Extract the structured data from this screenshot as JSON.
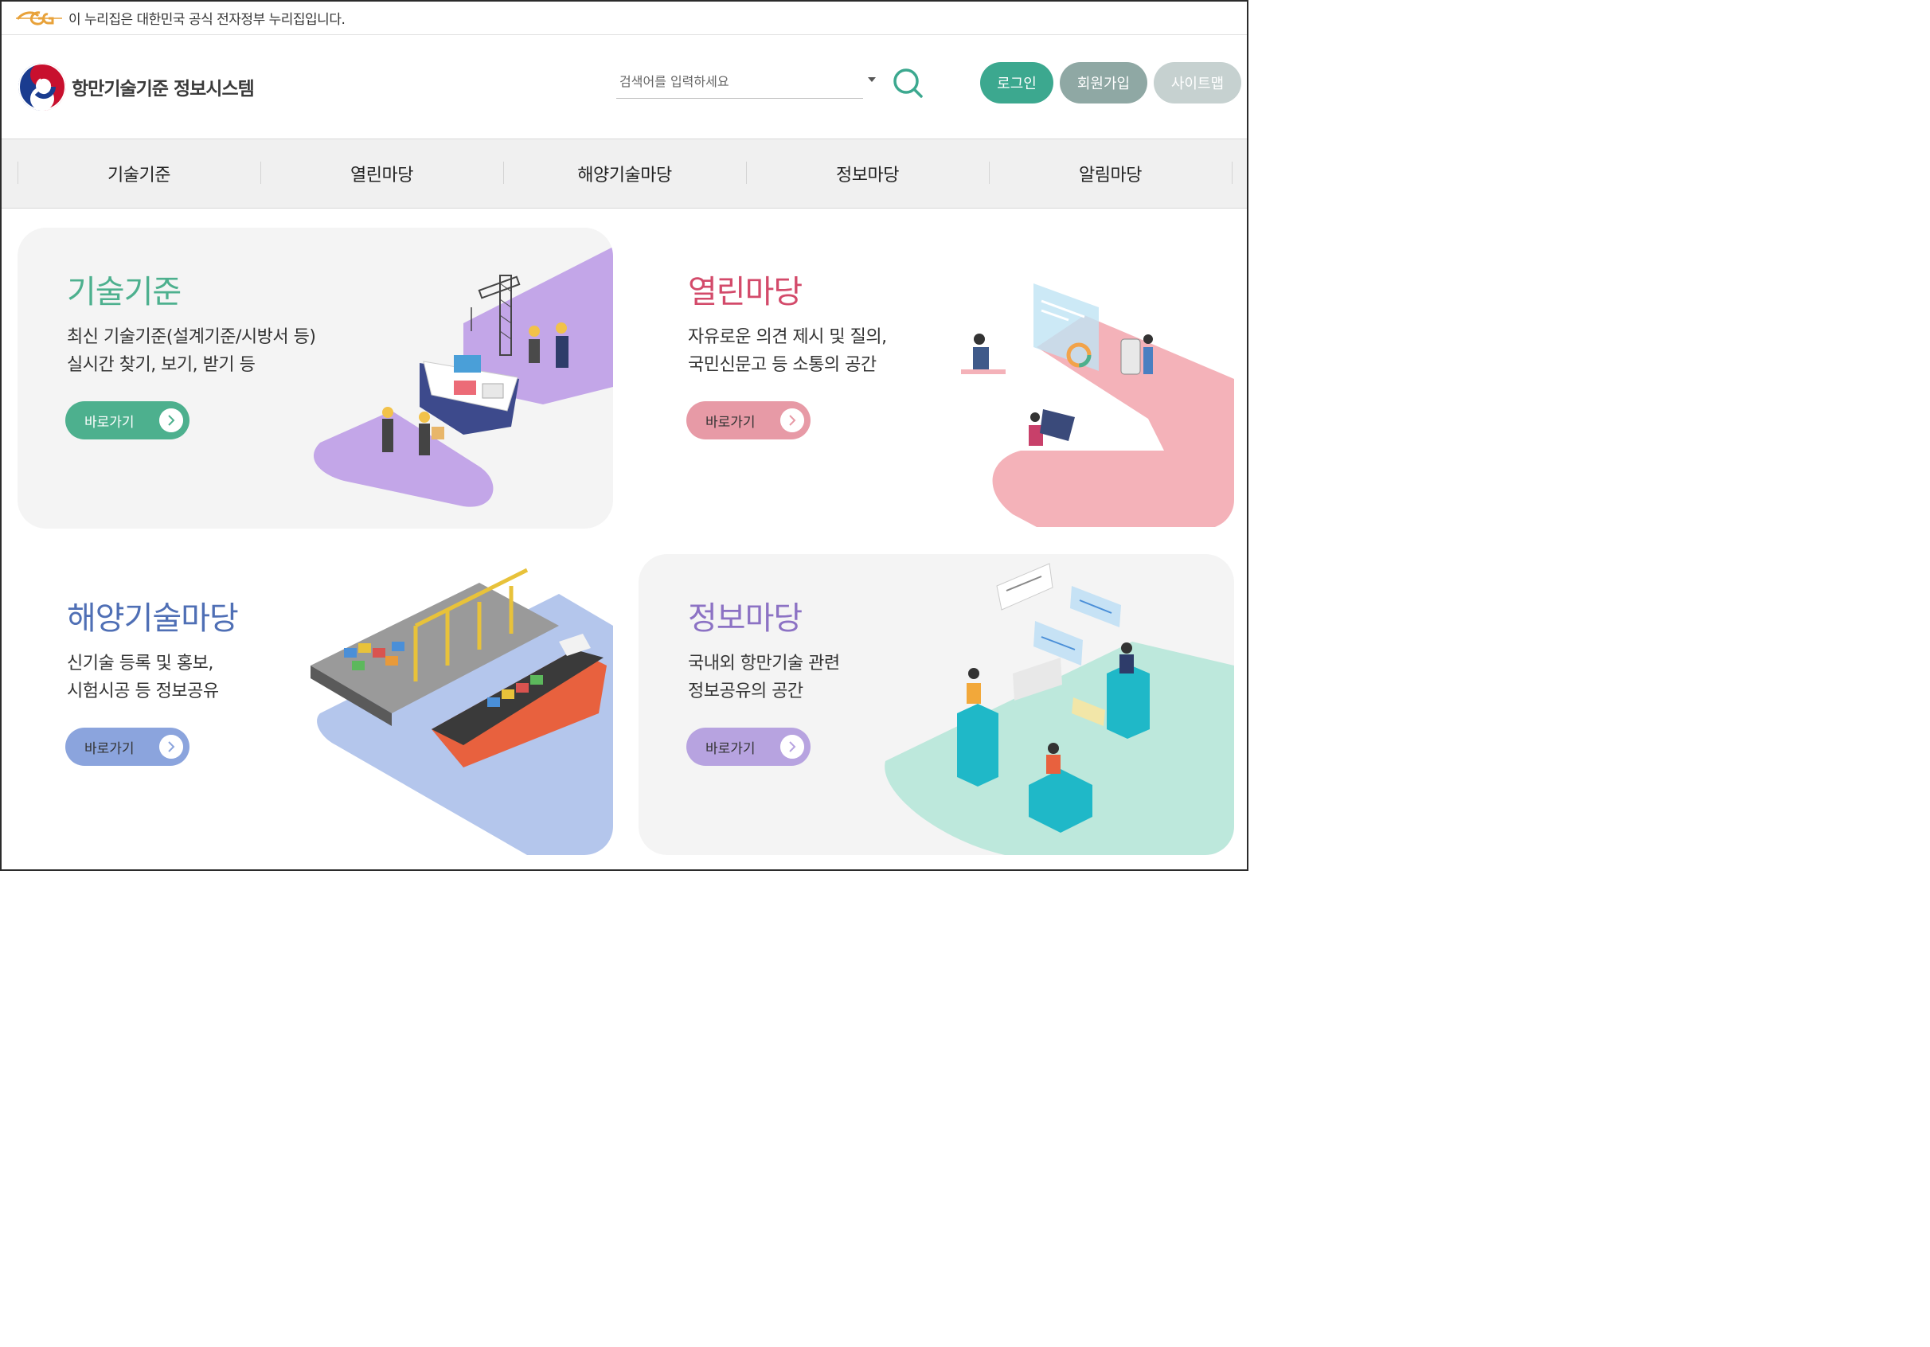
{
  "gov_banner": {
    "text": "이 누리집은 대한민국 공식 전자정부 누리집입니다."
  },
  "header": {
    "site_name": "항만기술기준 정보시스템",
    "search_placeholder": "검색어를 입력하세요",
    "buttons": {
      "login": "로그인",
      "join": "회원가입",
      "sitemap": "사이트맵"
    }
  },
  "nav": {
    "items": [
      {
        "label": "기술기준"
      },
      {
        "label": "열린마당"
      },
      {
        "label": "해양기술마당"
      },
      {
        "label": "정보마당"
      },
      {
        "label": "알림마당"
      }
    ]
  },
  "cards": {
    "tech_standard": {
      "title": "기술기준",
      "desc1": "최신 기술기준(설계기준/시방서 등)",
      "desc2": "실시간 찾기, 보기, 받기 등",
      "button": "바로가기",
      "color": "#4db08e"
    },
    "open_forum": {
      "title": "열린마당",
      "desc1": "자유로운 의견 제시 및 질의,",
      "desc2": "국민신문고 등 소통의 공간",
      "button": "바로가기",
      "color": "#d34a6a"
    },
    "marine_tech": {
      "title": "해양기술마당",
      "desc1": "신기술 등록 및 홍보,",
      "desc2": "시험시공 등 정보공유",
      "button": "바로가기",
      "color": "#4f6fb5"
    },
    "info_forum": {
      "title": "정보마당",
      "desc1": "국내외 항만기술 관련",
      "desc2": "정보공유의 공간",
      "button": "바로가기",
      "color": "#8c72c4"
    }
  }
}
